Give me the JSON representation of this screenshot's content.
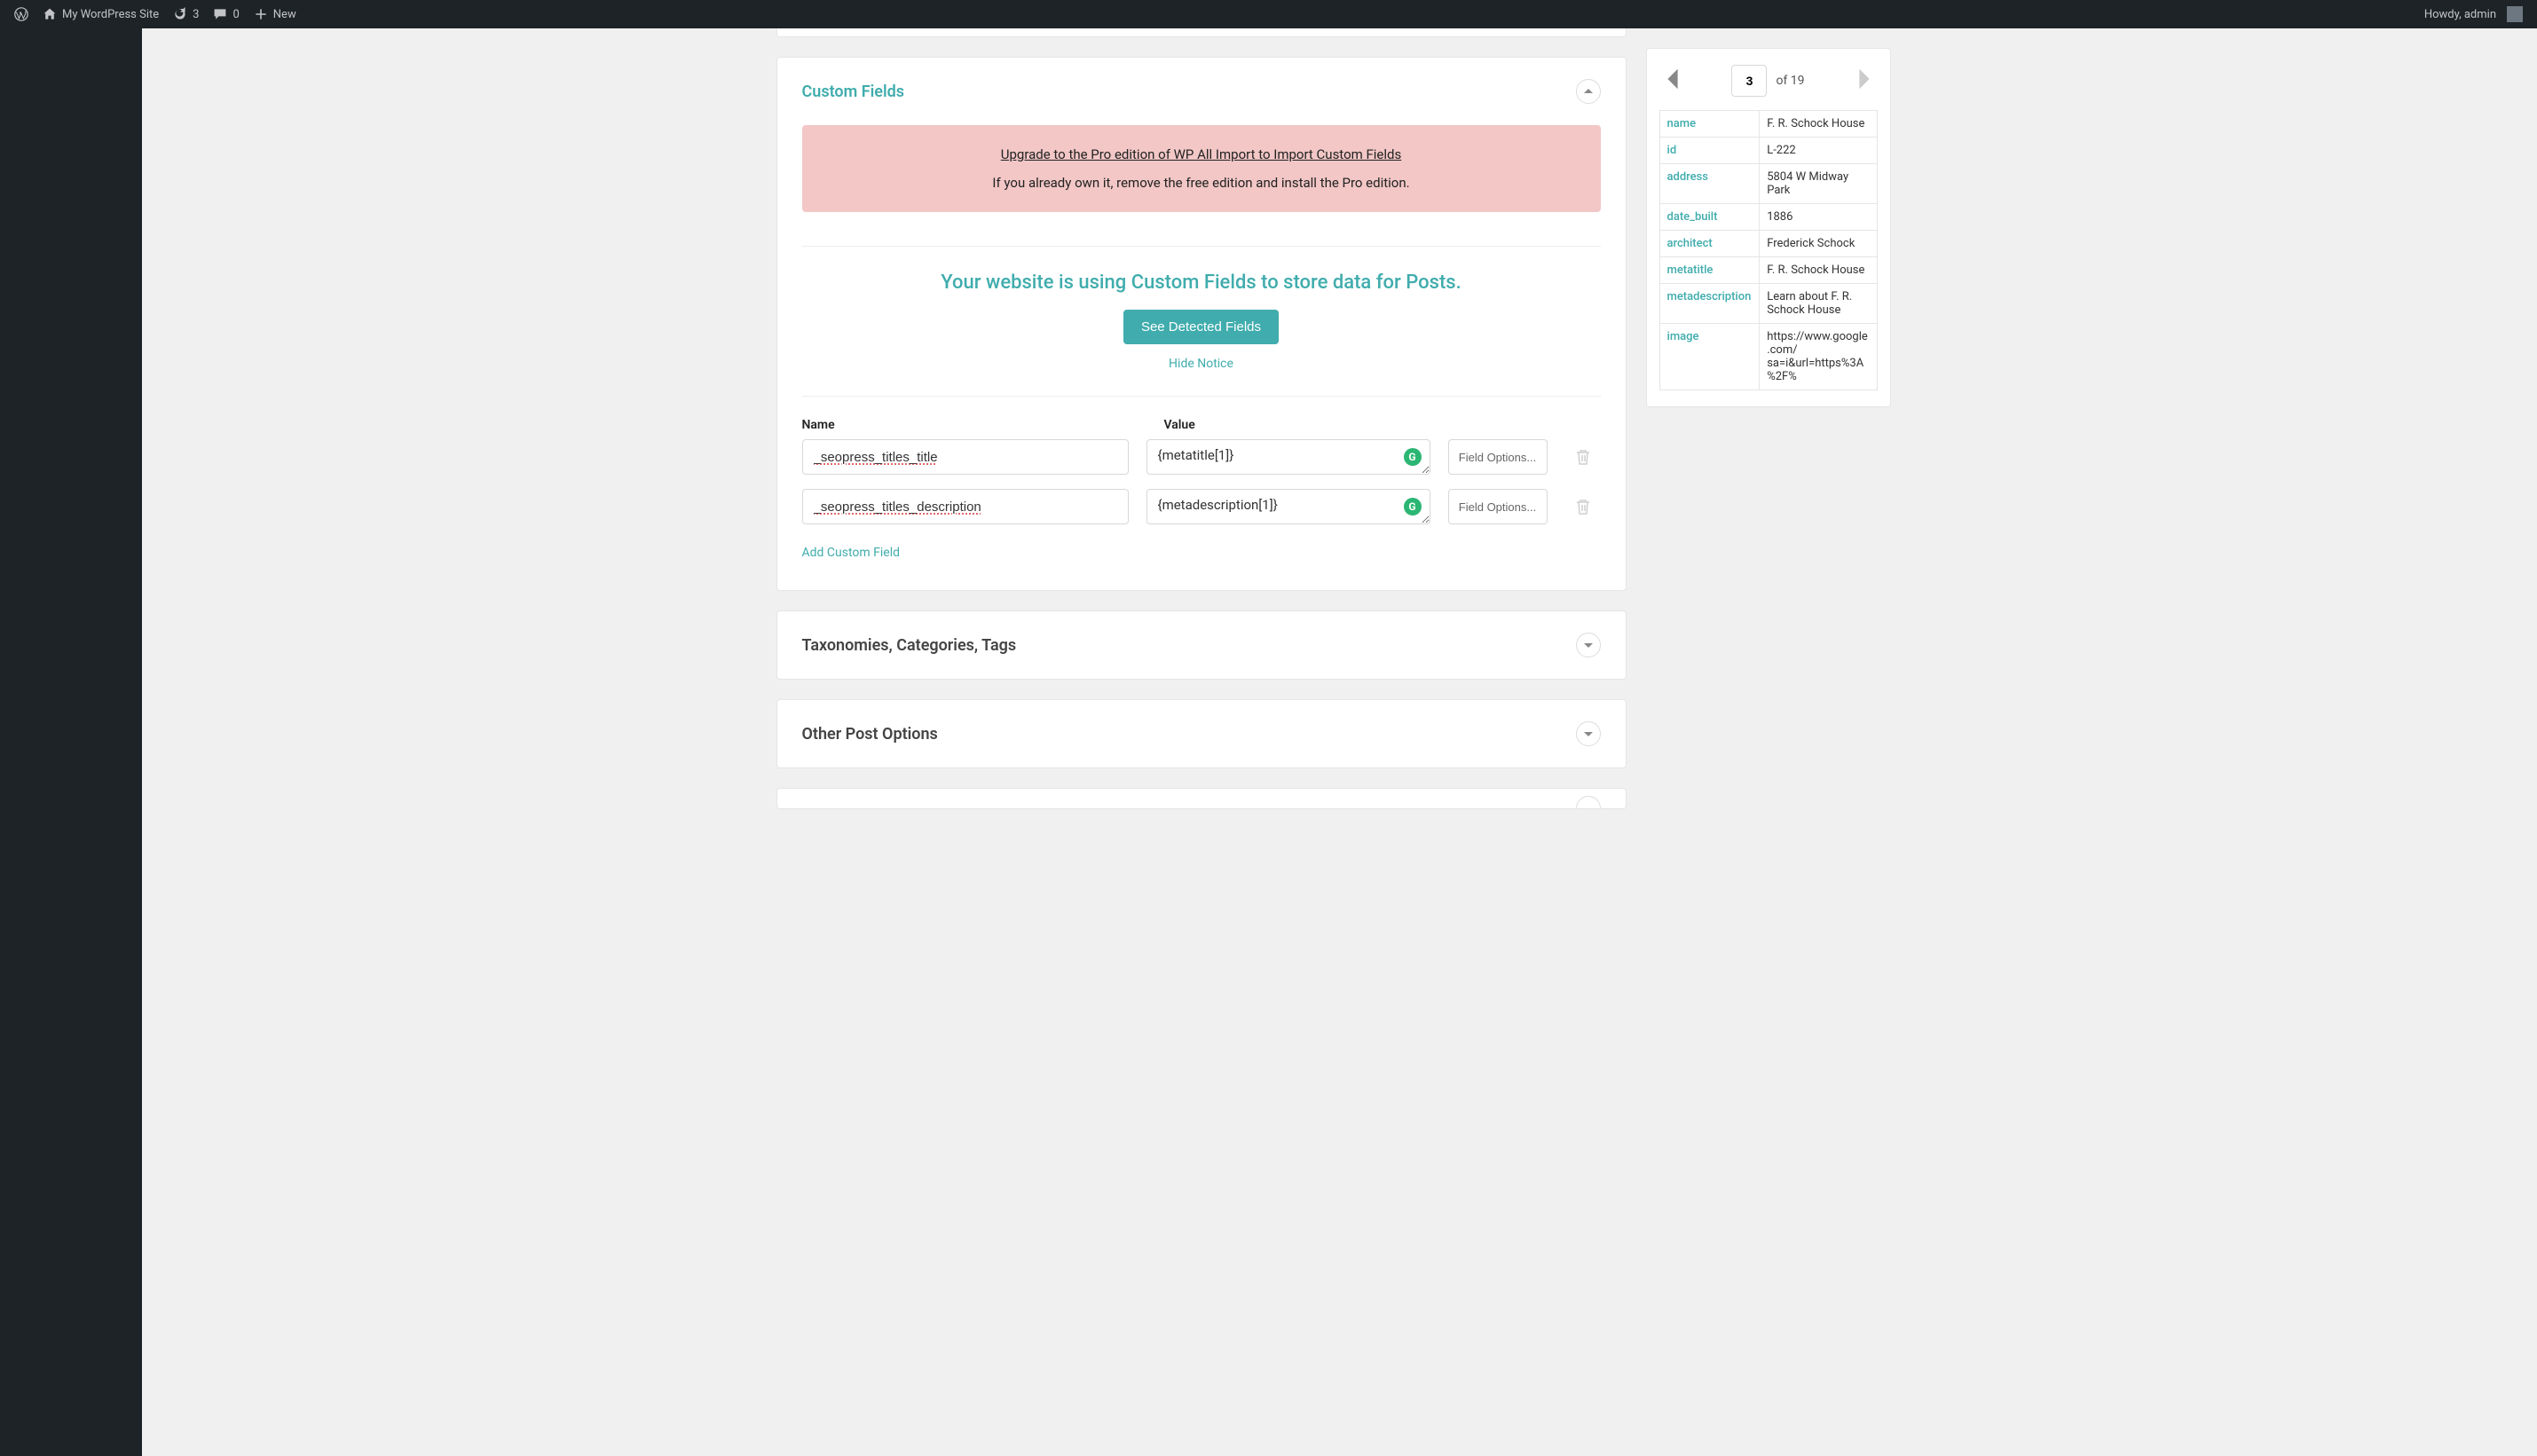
{
  "adminbar": {
    "site_name": "My WordPress Site",
    "updates_count": "3",
    "comments_count": "0",
    "new_label": "New",
    "howdy": "Howdy, admin"
  },
  "custom_fields_panel": {
    "title": "Custom Fields",
    "upgrade_title": "Upgrade to the Pro edition of WP All Import to Import Custom Fields",
    "upgrade_sub": "If you already own it, remove the free edition and install the Pro edition.",
    "detect_heading": "Your website is using Custom Fields to store data for Posts.",
    "detect_btn": "See Detected Fields",
    "hide_notice": "Hide Notice",
    "col_name": "Name",
    "col_value": "Value",
    "rows": [
      {
        "name": "_seopress_titles_title",
        "value": "{metatitle[1]}"
      },
      {
        "name": "_seopress_titles_description",
        "value": "{metadescription[1]}"
      }
    ],
    "field_options_label": "Field Options...",
    "add_field": "Add Custom Field"
  },
  "taxonomies_panel": {
    "title": "Taxonomies, Categories, Tags"
  },
  "other_post_panel": {
    "title": "Other Post Options"
  },
  "record": {
    "position": "3",
    "total_label": "of 19",
    "fields": [
      {
        "key": "name",
        "value": "F. R. Schock House"
      },
      {
        "key": "id",
        "value": "L-222"
      },
      {
        "key": "address",
        "value": "5804 W Midway Park"
      },
      {
        "key": "date_built",
        "value": "1886"
      },
      {
        "key": "architect",
        "value": "Frederick Schock"
      },
      {
        "key": "metatitle",
        "value": "F. R. Schock House"
      },
      {
        "key": "metadescription",
        "value": "Learn about F. R. Schock House"
      },
      {
        "key": "image",
        "value": "https://www.google.com/ sa=i&url=https%3A%2F%"
      }
    ]
  }
}
